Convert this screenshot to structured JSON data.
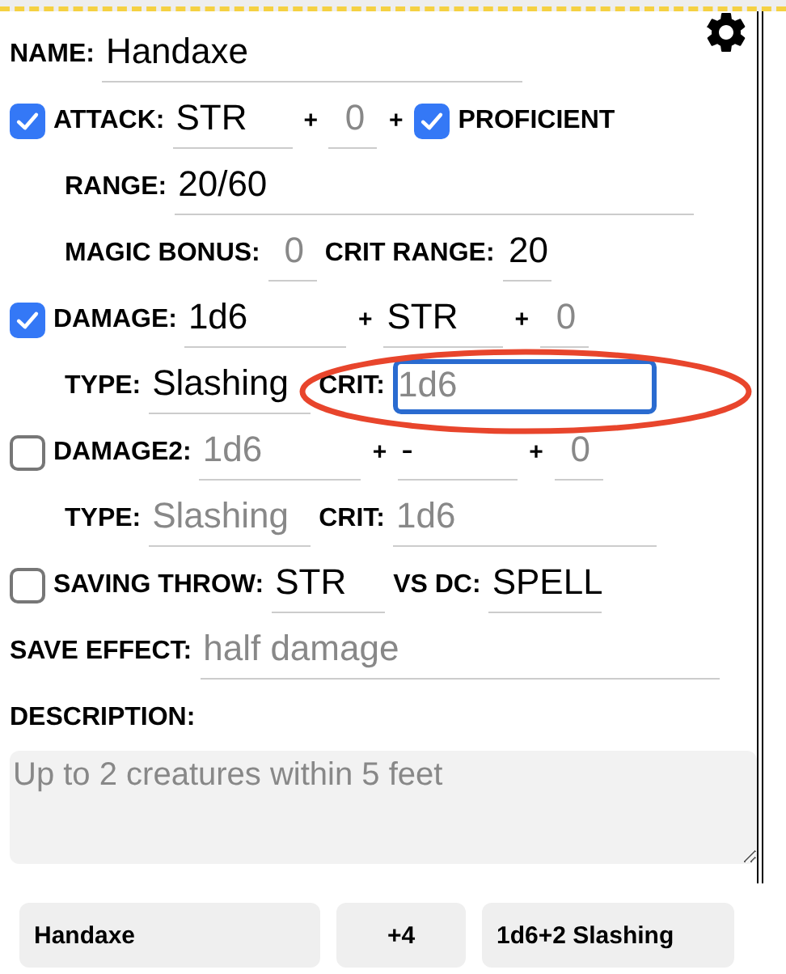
{
  "name_field": {
    "label": "NAME:",
    "value": "Handaxe"
  },
  "attack": {
    "checked": true,
    "label": "ATTACK:",
    "ability": {
      "value": "STR"
    },
    "plus": "+",
    "bonus": {
      "placeholder": "0"
    },
    "plus_2": "+",
    "proficient": {
      "checked": true,
      "label": "PROFICIENT"
    }
  },
  "range": {
    "label": "RANGE:",
    "value": "20/60"
  },
  "magic_bonus": {
    "label": "MAGIC BONUS:",
    "placeholder": "0"
  },
  "crit_range": {
    "label": "CRIT RANGE:",
    "value": "20"
  },
  "damages": [
    {
      "checked": true,
      "label": "DAMAGE:",
      "dice": {
        "value": "1d6"
      },
      "plus": "+",
      "ability": {
        "value": "STR"
      },
      "plus_2": "+",
      "bonus": {
        "placeholder": "0"
      },
      "type_label": "TYPE:",
      "type": {
        "value": "Slashing"
      },
      "crit_label": "CRIT:",
      "crit": {
        "placeholder": "1d6",
        "focused": true
      }
    },
    {
      "checked": false,
      "label": "DAMAGE2:",
      "dice": {
        "placeholder": "1d6"
      },
      "plus": "+",
      "ability": {
        "value": "-"
      },
      "plus_2": "+",
      "bonus": {
        "placeholder": "0"
      },
      "type_label": "TYPE:",
      "type": {
        "placeholder": "Slashing"
      },
      "crit_label": "CRIT:",
      "crit": {
        "placeholder": "1d6",
        "focused": false
      }
    }
  ],
  "saving_throw": {
    "checked": false,
    "label": "SAVING THROW:",
    "ability": {
      "value": "STR"
    },
    "vs_label": "VS DC:",
    "dc": {
      "value": "SPELL"
    }
  },
  "save_effect": {
    "label": "SAVE EFFECT:",
    "placeholder": "half damage"
  },
  "description": {
    "label": "DESCRIPTION:",
    "placeholder": "Up to 2 creatures within 5 feet"
  },
  "summary": [
    "Handaxe",
    "+4",
    "1d6+2 Slashing"
  ],
  "annotation": {
    "kind": "ellipse"
  }
}
